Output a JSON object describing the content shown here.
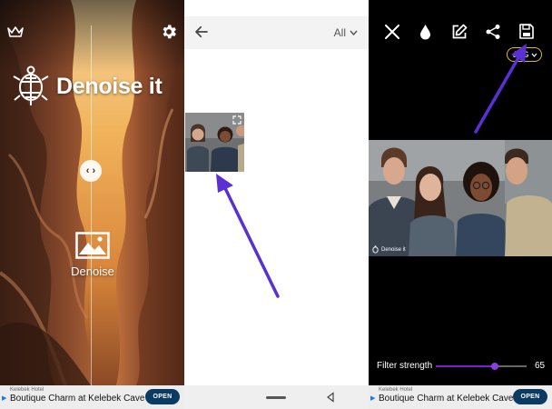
{
  "denoise_home": {
    "app_name": "Denoise it",
    "action_label": "Denoise"
  },
  "gallery": {
    "filter_label": "All"
  },
  "editor": {
    "format_label": "JPG",
    "watermark": "Denoise it",
    "filter_strength_label": "Filter strength",
    "filter_strength_value": "65",
    "filter_strength_percent": 65
  },
  "ads": {
    "left": {
      "tag": "Kelebek Hotel",
      "title": "Boutique Charm at Kelebek Cave",
      "button": "OPEN"
    },
    "right": {
      "tag": "Kelebek Hotel",
      "title": "Boutique Charm at Kelebek Cave",
      "button": "OPEN"
    }
  },
  "icons": [
    "crown-icon",
    "gear-icon",
    "turtle-logo-icon",
    "split-handle-icon",
    "image-icon",
    "back-arrow-icon",
    "chevron-down-icon",
    "expand-icon",
    "close-icon",
    "drop-icon",
    "edit-icon",
    "share-icon",
    "save-icon",
    "nav-back-icon"
  ],
  "colors": {
    "accent_purple": "#5b2fd6",
    "slider": "#7a1fd8",
    "chip_border": "#e0b341",
    "ad_button": "#0b3a63"
  }
}
